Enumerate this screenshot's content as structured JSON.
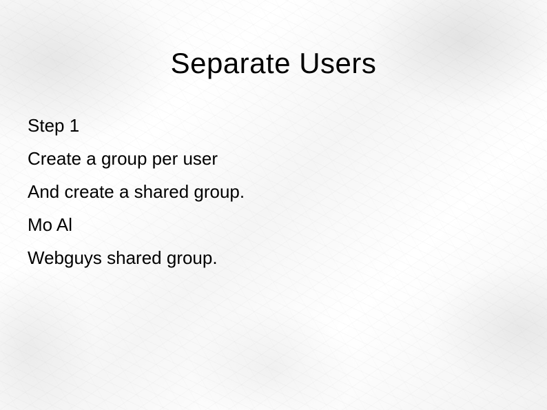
{
  "slide": {
    "title": "Separate Users",
    "lines": {
      "l1": "Step 1",
      "l2": "Create a group per user",
      "l3": "And create a shared group.",
      "l4": "Mo  Al",
      "l5": "Webguys shared group."
    }
  }
}
